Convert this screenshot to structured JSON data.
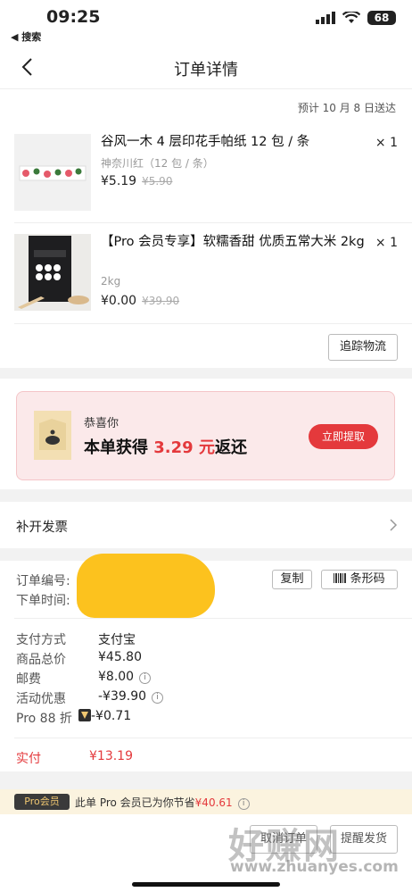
{
  "status_bar": {
    "time": "09:25",
    "back_app": "◀ 搜索",
    "battery": "68"
  },
  "nav": {
    "title": "订单详情"
  },
  "order": {
    "delivery_note": "预计 10 月 8 日送达",
    "items": [
      {
        "name": "谷风一木 4 层印花手帕纸 12 包 / 条",
        "spec": "神奈川红（12 包 / 条）",
        "price": "¥5.19",
        "original_price": "¥5.90",
        "qty": "× 1"
      },
      {
        "name": "【Pro 会员专享】软糯香甜 优质五常大米 2kg",
        "spec": "2kg",
        "price": "¥0.00",
        "original_price": "¥39.90",
        "qty": "× 1"
      }
    ],
    "track_button": "追踪物流"
  },
  "rebate": {
    "sub": "恭喜你",
    "main_prefix": "本单获得",
    "amount": "3.29 元",
    "main_suffix": "返还",
    "button": "立即提取"
  },
  "invoice": {
    "label": "补开发票"
  },
  "order_meta": {
    "order_no_label": "订单编号:",
    "order_time_label": "下单时间:",
    "copy_button": "复制",
    "barcode_button": "条形码"
  },
  "payment": {
    "rows": [
      {
        "label": "支付方式",
        "value": "支付宝"
      },
      {
        "label": "商品总价",
        "value": "¥45.80"
      },
      {
        "label": "邮费",
        "value": "¥8.00"
      },
      {
        "label": "活动优惠",
        "value": "-¥39.90"
      },
      {
        "label": "Pro 88 折",
        "value": "-¥0.71"
      }
    ],
    "paid_label": "实付",
    "paid_value": "¥13.19"
  },
  "pro_bar": {
    "badge": "Pro会员",
    "text": "此单 Pro 会员已为你节省",
    "amount": "¥40.61"
  },
  "bottom": {
    "btn_left": "取消订单",
    "btn_right": "提醒发货"
  },
  "watermark": {
    "text": "好赚网",
    "url": "www.zhuanyes.com"
  },
  "colors": {
    "accent": "#e4393c",
    "pro_gold": "#f0c771"
  }
}
